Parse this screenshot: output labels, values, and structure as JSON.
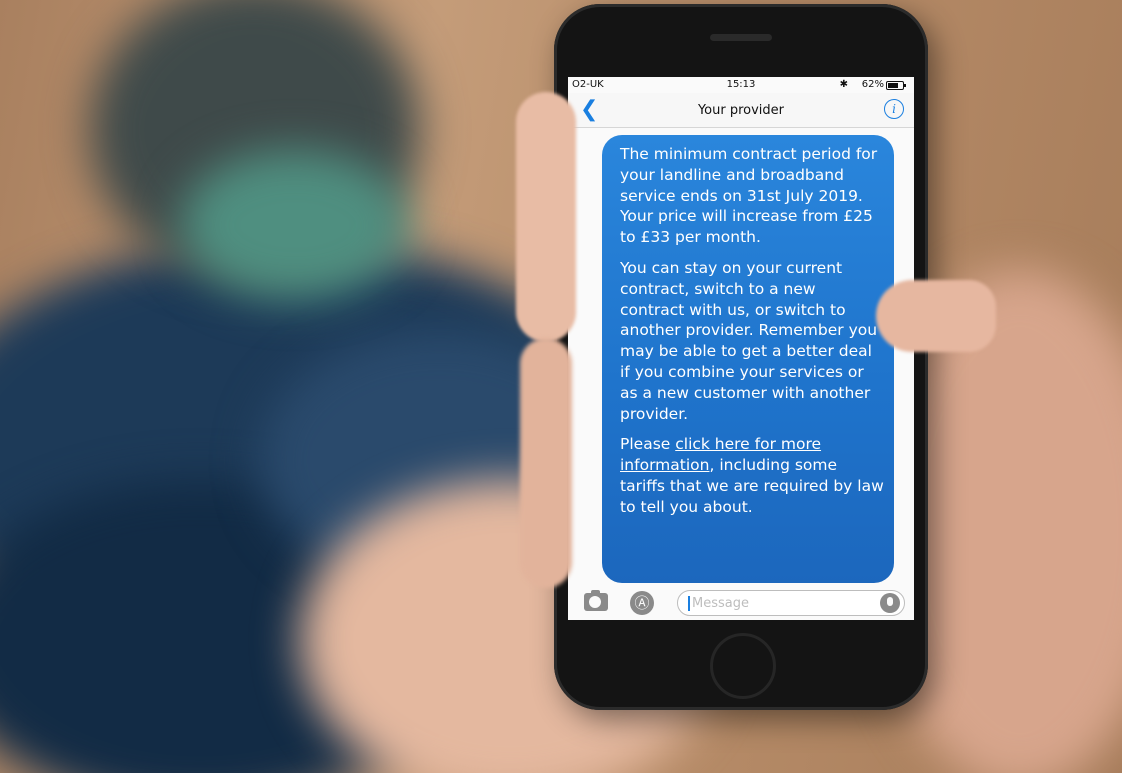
{
  "status_bar": {
    "carrier": "O2-UK",
    "time": "15:13",
    "battery": "62%"
  },
  "nav": {
    "title": "Your provider"
  },
  "message": {
    "paragraph1": "The minimum contract period for your landline and broadband service ends on 31st July 2019. Your price will increase from £25 to £33 per month.",
    "paragraph2": "You can stay on your current contract, switch to a new contract with us, or switch to another provider. Remember you may be able to get a better deal if you combine your services or as a new customer with another provider.",
    "paragraph3_prefix": "Please ",
    "paragraph3_link": "click here for more information",
    "paragraph3_suffix": ", including some tariffs that we are required by law to tell you about."
  },
  "input_bar": {
    "placeholder": "Message",
    "value": ""
  },
  "icons": {
    "back": "chevron-left-icon",
    "info": "info-icon",
    "camera": "camera-icon",
    "appstore": "app-store-icon",
    "mic": "microphone-icon"
  },
  "colors": {
    "bubble": "#1f74cc",
    "accent": "#1a7fe0"
  }
}
